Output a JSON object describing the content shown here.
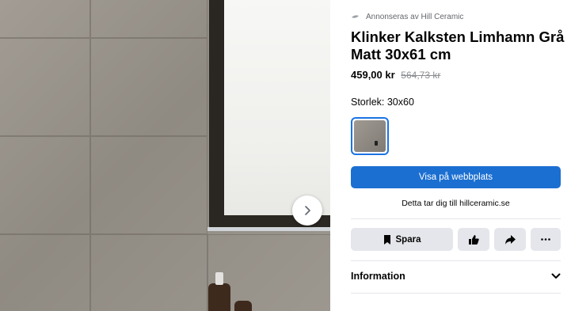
{
  "ad": {
    "sponsor_text": "Annonseras av Hill Ceramic",
    "sponsor_logo_icon": "leaf-logo-icon"
  },
  "product": {
    "title": "Klinker Kalksten Limhamn Grå Matt 30x61 cm",
    "price": "459,00 kr",
    "old_price": "564,73 kr",
    "size_label": "Storlek: 30x60"
  },
  "cta": {
    "label": "Visa på webbplats",
    "subtext": "Detta tar dig till hillceramic.se"
  },
  "actions": {
    "save_label": "Spara",
    "save_icon": "bookmark-icon",
    "like_icon": "thumbs-up-icon",
    "share_icon": "share-arrow-icon",
    "more_icon": "more-dots-icon"
  },
  "info": {
    "label": "Information",
    "icon": "chevron-down-icon"
  },
  "media": {
    "next_icon": "chevron-right-icon"
  },
  "colors": {
    "accent": "#1b6fd1",
    "selected_border": "#1b74e4",
    "button_bg": "#e4e6eb"
  }
}
